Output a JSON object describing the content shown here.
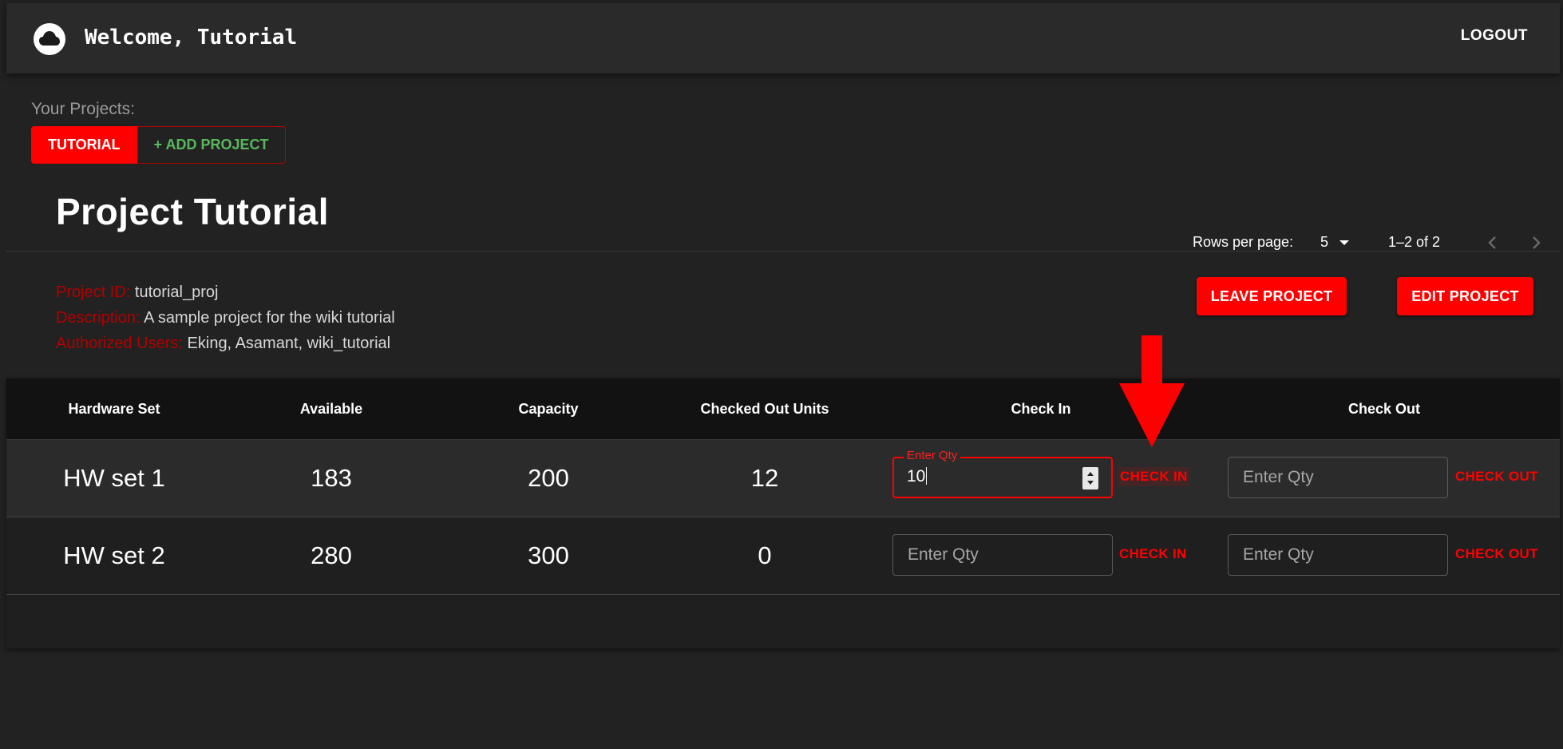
{
  "header": {
    "welcome": "Welcome, Tutorial",
    "logout": "LOGOUT",
    "logo_icon": "cloud-icon"
  },
  "projects": {
    "label": "Your Projects:",
    "active_tab": "TUTORIAL",
    "add_tab": "+ ADD PROJECT"
  },
  "project": {
    "title": "Project Tutorial",
    "id_label": "Project ID:",
    "id_value": "tutorial_proj",
    "desc_label": "Description:",
    "desc_value": "A sample project for the wiki tutorial",
    "users_label": "Authorized Users:",
    "users_value": "Eking, Asamant, wiki_tutorial",
    "leave_button": "LEAVE PROJECT",
    "edit_button": "EDIT PROJECT"
  },
  "table": {
    "columns": [
      "Hardware Set",
      "Available",
      "Capacity",
      "Checked Out Units",
      "Check In",
      "Check Out"
    ],
    "rows": [
      {
        "name": "HW set 1",
        "available": "183",
        "capacity": "200",
        "checked_out": "12",
        "checkin_label": "Enter Qty",
        "checkin_value": "10",
        "checkin_action": "CHECK IN",
        "checkout_placeholder": "Enter Qty",
        "checkout_action": "CHECK OUT"
      },
      {
        "name": "HW set 2",
        "available": "280",
        "capacity": "300",
        "checked_out": "0",
        "checkin_placeholder": "Enter Qty",
        "checkin_action": "CHECK IN",
        "checkout_placeholder": "Enter Qty",
        "checkout_action": "CHECK OUT"
      }
    ]
  },
  "pagination": {
    "rows_per_page_label": "Rows per page:",
    "rows_per_page_value": "5",
    "range": "1–2 of 2"
  },
  "colors": {
    "accent": "#ff0000",
    "label_red": "#b30000",
    "add_green": "#59b75e",
    "background": "#222222"
  }
}
